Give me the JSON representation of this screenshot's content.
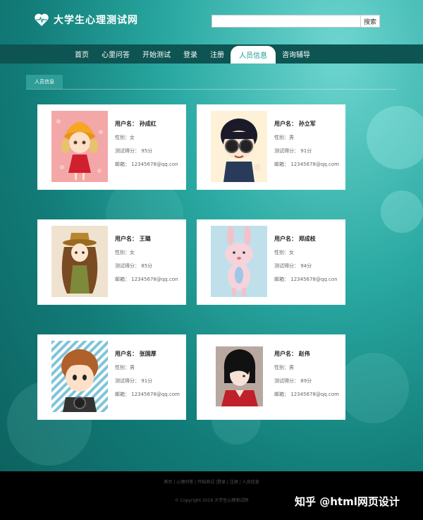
{
  "header": {
    "site_title": "大学生心理测试网",
    "search_placeholder": "",
    "search_button": "搜索"
  },
  "nav": {
    "items": [
      "首页",
      "心里问答",
      "开始测试",
      "登录",
      "注册",
      "人员信息",
      "咨询辅导"
    ],
    "active_index": 5
  },
  "breadcrumb": "人员信息",
  "labels": {
    "username": "用户名：",
    "gender": "性别：",
    "score": "测试得分：",
    "email": "邮箱："
  },
  "people": [
    {
      "name": "孙成红",
      "gender": "女",
      "score": "95分",
      "email": "12345678@qq.con"
    },
    {
      "name": "孙立军",
      "gender": "男",
      "score": "91分",
      "email": "12345678@qq.com"
    },
    {
      "name": "王璐",
      "gender": "女",
      "score": "85分",
      "email": "12345678@qq.con"
    },
    {
      "name": "郑成枝",
      "gender": "女",
      "score": "94分",
      "email": "12345678@qq.con"
    },
    {
      "name": "张国厚",
      "gender": "男",
      "score": "91分",
      "email": "12345678@qq.com"
    },
    {
      "name": "赵伟",
      "gender": "男",
      "score": "89分",
      "email": "12345678@qq.com"
    }
  ],
  "footer": {
    "links": "首页 | 心理问答 | 开始测试 |登录 | 注册 | 人员信息",
    "copyright": "© Copyright 2019 大学生心理测试网"
  },
  "watermark": "知乎 @html网页设计",
  "colors": {
    "nav_bg": "#0d5452",
    "accent": "#1a9a94",
    "crumb_bg": "#2f9e98",
    "footer_bg": "#000000"
  }
}
